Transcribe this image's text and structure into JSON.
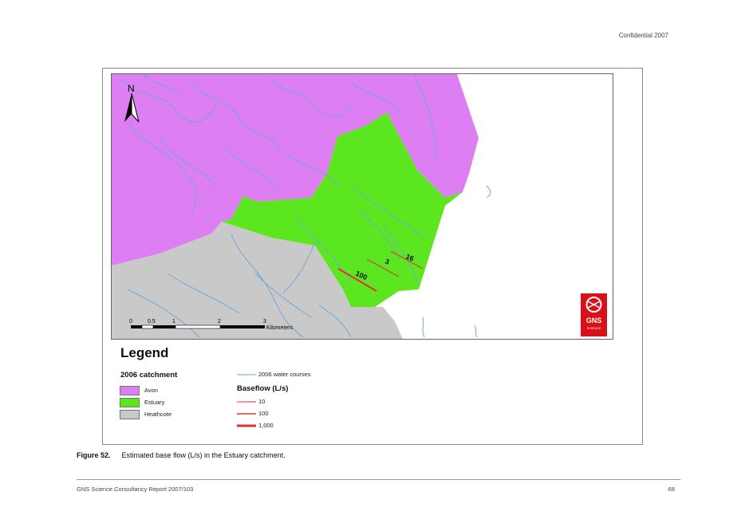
{
  "header": {
    "confidential": "Confidential 2007"
  },
  "map": {
    "north_label": "N",
    "scale": {
      "ticks": [
        "0",
        "0.5",
        "1",
        "2",
        "3"
      ],
      "unit": "Kilometers"
    },
    "baseflow_labels": [
      "16",
      "3",
      "100"
    ],
    "logo_text": "GNS",
    "logo_subtext": "SCIENCE",
    "colors": {
      "avon": "#dd7ef2",
      "estuary": "#5be61f",
      "heathcote": "#c9c9c9",
      "water": "#6fa9d6",
      "baseflow": "#e8302a"
    }
  },
  "legend": {
    "title": "Legend",
    "catchment_title": "2006 catchment",
    "catchments": [
      {
        "label": "Avon",
        "color": "#dd7ef2"
      },
      {
        "label": "Estuary",
        "color": "#5be61f"
      },
      {
        "label": "Heathcote",
        "color": "#c9c9c9"
      }
    ],
    "water_label": "2006 water courses",
    "baseflow_title": "Baseflow (L/s)",
    "baseflow": [
      {
        "label": "10",
        "width": 1
      },
      {
        "label": "100",
        "width": 1.5
      },
      {
        "label": "1,000",
        "width": 3
      }
    ]
  },
  "caption": {
    "label": "Figure 52.",
    "text": "Estimated base flow (L/s) in the Estuary catchment."
  },
  "footer": {
    "left": "GNS Science Consultancy Report 2007/103",
    "right": "68"
  }
}
